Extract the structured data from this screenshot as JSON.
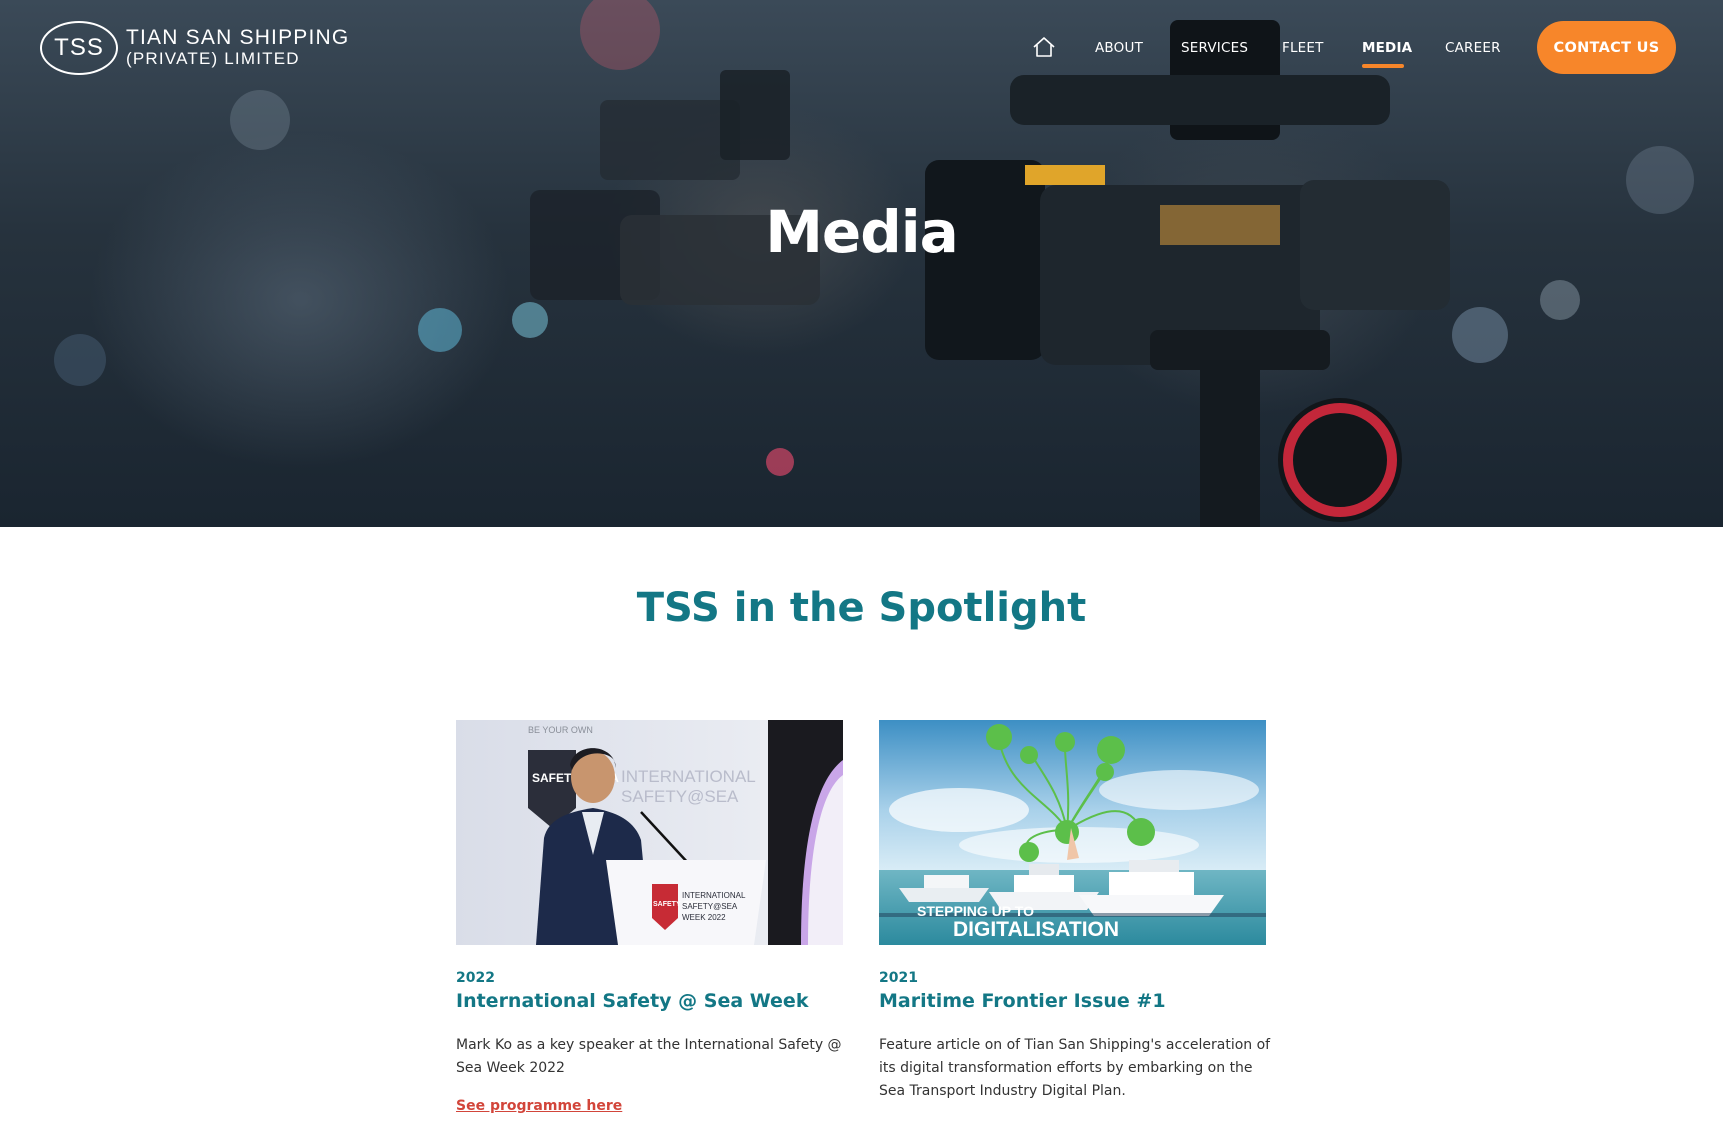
{
  "brand": {
    "logo_mark": "TSS",
    "name_line1": "TIAN SAN SHIPPING",
    "name_line2": "(PRIVATE) LIMITED"
  },
  "nav": {
    "home_icon": "home-icon",
    "items": [
      {
        "label": "ABOUT",
        "active": false
      },
      {
        "label": "SERVICES",
        "active": false
      },
      {
        "label": "FLEET",
        "active": false
      },
      {
        "label": "MEDIA",
        "active": true
      },
      {
        "label": "CAREER",
        "active": false
      }
    ],
    "cta": "CONTACT US"
  },
  "hero": {
    "title": "Media"
  },
  "spotlight": {
    "title": "TSS in the Spotlight",
    "cards": [
      {
        "year": "2022",
        "title": "International Safety @ Sea Week",
        "description": "Mark Ko as a key speaker at the International Safety @ Sea Week 2022",
        "link": "See programme here",
        "image_text": {
          "backdrop_top": "BE YOUR OWN",
          "backdrop_shield": "SAFETY @SEA",
          "backdrop_line1": "INTERNATIONAL",
          "backdrop_line2": "SAFETY@SEA",
          "podium_line1": "INTERNATIONAL",
          "podium_line2": "SAFETY@SEA",
          "podium_line3": "WEEK 2022",
          "podium_shield": "SAFETY @SEA"
        }
      },
      {
        "year": "2021",
        "title": "Maritime Frontier Issue #1",
        "description": "Feature article on of Tian San Shipping's acceleration of its digital transformation efforts by embarking on the Sea Transport Industry Digital Plan.",
        "link": "",
        "image_text": {
          "line1": "STEPPING UP TO",
          "line2": "DIGITALISATION"
        }
      }
    ]
  },
  "colors": {
    "accent": "#f7862a",
    "teal": "#137785",
    "link": "#d2453a"
  }
}
